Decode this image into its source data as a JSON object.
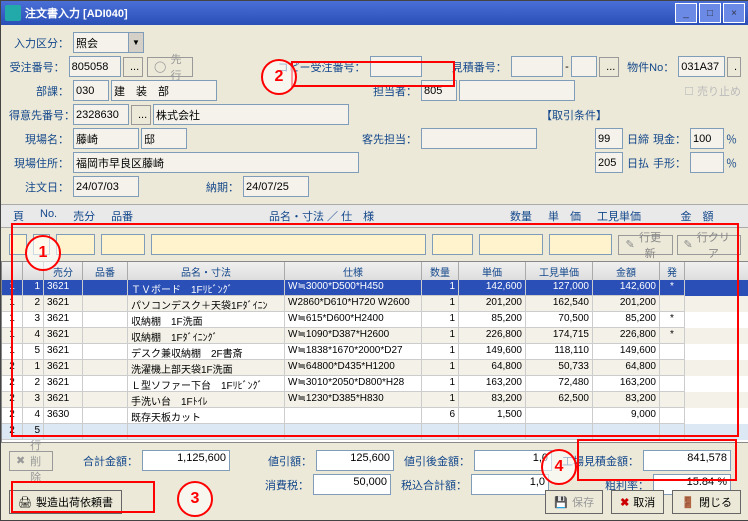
{
  "window": {
    "title": "注文書入力 [ADI040]"
  },
  "callouts": {
    "c1": "1",
    "c2": "2",
    "c3": "3",
    "c4": "4"
  },
  "form": {
    "nyuryoku_kubun_lbl": "入力区分：",
    "nyuryoku_kubun_val": "照会",
    "juchu_no_lbl": "受注番号：",
    "juchu_no_val": "805058",
    "senko_btn": "先行",
    "copy_juchu_lbl": "コピー受注番号：",
    "copy_juchu_val": "",
    "mitsumori_no_lbl": "見積番号：",
    "mitsumori_val1": "",
    "mitsumori_val2": "",
    "bukken_no_lbl": "物件No：",
    "bukken_no_val": "031A37",
    "buka_lbl": "部課：",
    "buka_val": "030",
    "buka_name": "建　装　部",
    "tantou_lbl": "担当者：",
    "tantou_val": "805",
    "uridome_lbl": "売り止め",
    "tokui_no_lbl": "得意先番号：",
    "tokui_val": "2328630",
    "tokui_name": "株式会社",
    "torihiki_lbl": "【取引条件】",
    "genba_mei_lbl": "現場名：",
    "genba_mei_v1": "藤崎",
    "genba_mei_v2": "邸",
    "kyakusaki_lbl": "客先担当：",
    "kyakusaki_val": "",
    "shimebi": "99",
    "shimebi_lbl": "日締",
    "genkin_lbl": "現金：",
    "genkin_val": "100",
    "pct1": "％",
    "nissu2": "205",
    "hibarai_lbl": "日払",
    "tegata_lbl": "手形：",
    "tegata_val": "",
    "pct2": "％",
    "genba_addr_lbl": "現場住所：",
    "genba_addr_val": "福岡市早良区藤崎",
    "chumonbi_lbl": "注文日：",
    "chumonbi_val": "24/07/03",
    "nouki_lbl": "納期：",
    "nouki_val": "24/07/25"
  },
  "gridheader": {
    "g": "頁",
    "l": "No.",
    "ub": "売分",
    "hin": "品番",
    "nmsp": "品名・寸法 ／ 仕　様",
    "qty": "数量",
    "tan": "単　価",
    "kmi": "工見単価",
    "kin": "金　額"
  },
  "subbtns": {
    "update": "行更新",
    "clear": "行クリア"
  },
  "gridcols": {
    "g": "",
    "l": "",
    "ub": "売分",
    "hin": "品番",
    "nm": "品名・寸法",
    "sp": "仕様",
    "qty": "数量",
    "tan": "単価",
    "kmi": "工見単価",
    "kin": "金額",
    "h": "発"
  },
  "rows": [
    {
      "g": "1",
      "l": "1",
      "ub": "3621",
      "hin": "",
      "nm": "ＴＶボード　1Fﾘﾋﾞﾝｸﾞ",
      "sp": "W≒3000*D500*H450",
      "qty": "1",
      "tan": "142,600",
      "kmi": "127,000",
      "kin": "142,600",
      "h": "*",
      "sel": true
    },
    {
      "g": "1",
      "l": "2",
      "ub": "3621",
      "hin": "",
      "nm": "パソコンデスク＋天袋1Fﾀﾞｲﾆﾝ",
      "sp": "W2860*D610*H720 W2600",
      "qty": "1",
      "tan": "201,200",
      "kmi": "162,540",
      "kin": "201,200",
      "h": ""
    },
    {
      "g": "1",
      "l": "3",
      "ub": "3621",
      "hin": "",
      "nm": "収納棚　1F洗面",
      "sp": "W≒615*D600*H2400",
      "qty": "1",
      "tan": "85,200",
      "kmi": "70,500",
      "kin": "85,200",
      "h": "*"
    },
    {
      "g": "1",
      "l": "4",
      "ub": "3621",
      "hin": "",
      "nm": "収納棚　1Fﾀﾞｲﾆﾝｸﾞ",
      "sp": "W≒1090*D387*H2600",
      "qty": "1",
      "tan": "226,800",
      "kmi": "174,715",
      "kin": "226,800",
      "h": "*"
    },
    {
      "g": "1",
      "l": "5",
      "ub": "3621",
      "hin": "",
      "nm": "デスク兼収納棚　2F書斎",
      "sp": "W≒1838*1670*2000*D27",
      "qty": "1",
      "tan": "149,600",
      "kmi": "118,110",
      "kin": "149,600",
      "h": ""
    },
    {
      "g": "2",
      "l": "1",
      "ub": "3621",
      "hin": "",
      "nm": "洗濯機上部天袋1F洗面",
      "sp": "W≒64800*D435*H1200",
      "qty": "1",
      "tan": "64,800",
      "kmi": "50,733",
      "kin": "64,800",
      "h": ""
    },
    {
      "g": "2",
      "l": "2",
      "ub": "3621",
      "hin": "",
      "nm": "Ｌ型ソファー下台　1Fﾘﾋﾞﾝｸﾞ",
      "sp": "W≒3010*2050*D800*H28",
      "qty": "1",
      "tan": "163,200",
      "kmi": "72,480",
      "kin": "163,200",
      "h": ""
    },
    {
      "g": "2",
      "l": "3",
      "ub": "3621",
      "hin": "",
      "nm": "手洗い台　1Fﾄｲﾚ",
      "sp": "W≒1230*D385*H830",
      "qty": "1",
      "tan": "83,200",
      "kmi": "62,500",
      "kin": "83,200",
      "h": ""
    },
    {
      "g": "2",
      "l": "4",
      "ub": "3630",
      "hin": "",
      "nm": "既存天板カット",
      "sp": "",
      "qty": "6",
      "tan": "1,500",
      "kmi": "",
      "kin": "9,000",
      "h": ""
    },
    {
      "g": "2",
      "l": "5",
      "ub": "",
      "hin": "",
      "nm": "",
      "sp": "",
      "qty": "",
      "tan": "",
      "kmi": "",
      "kin": "",
      "h": "",
      "last": true
    }
  ],
  "totals": {
    "gokei_lbl": "合計金額：",
    "gokei": "1,125,600",
    "nebiki_lbl": "値引額：",
    "nebiki": "125,600",
    "nebikigo_lbl": "値引後金額：",
    "nebikigo": "1,0",
    "syohizei_lbl": "消費税：",
    "syohizei": "50,000",
    "zeikomigokei_lbl": "税込合計額：",
    "zeikomigokei": "1,0",
    "koujoumitsumori_lbl": "工場見積金額：",
    "koujoumitsumori": "841,578",
    "arari_lbl": "粗利率：",
    "arari": "15.84",
    "pct": "%"
  },
  "bottom": {
    "row_del": "行削除",
    "seizoushukka": "製造出荷依頼書",
    "hozon": "保存",
    "torikeshi": "取消",
    "tojiru": "閉じる"
  }
}
